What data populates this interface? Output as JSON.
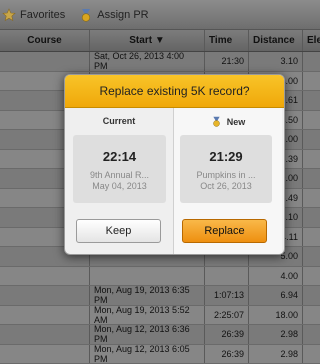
{
  "toolbar": {
    "items": [
      {
        "label": "Favorites",
        "icon": "star-icon"
      },
      {
        "label": "Assign PR",
        "icon": "medal-icon"
      }
    ]
  },
  "table": {
    "headers": [
      "Course",
      "Start ▼",
      "Time",
      "Distance",
      "Elev"
    ],
    "rows": [
      {
        "start": "Sat, Oct 26, 2013 4:00 PM",
        "time": "21:30",
        "distance": "3.10"
      },
      {
        "start": "",
        "time": "",
        "distance": "4.00"
      },
      {
        "start": "",
        "time": "",
        "distance": "26.61"
      },
      {
        "start": "",
        "time": "",
        "distance": "4.50"
      },
      {
        "start": "",
        "time": "",
        "distance": "6.00"
      },
      {
        "start": "",
        "time": "",
        "distance": "26.39"
      },
      {
        "start": "",
        "time": "",
        "distance": "9.00"
      },
      {
        "start": "",
        "time": "",
        "distance": "15.49"
      },
      {
        "start": "",
        "time": "",
        "distance": "3.10"
      },
      {
        "start": "",
        "time": "",
        "distance": "4.11"
      },
      {
        "start": "",
        "time": "",
        "distance": "5.00"
      },
      {
        "start": "",
        "time": "",
        "distance": "4.00"
      },
      {
        "start": "Mon, Aug 19, 2013 6:35 PM",
        "time": "1:07:13",
        "distance": "6.94"
      },
      {
        "start": "Mon, Aug 19, 2013 5:52 AM",
        "time": "2:25:07",
        "distance": "18.00"
      },
      {
        "start": "Mon, Aug 12, 2013 6:36 PM",
        "time": "26:39",
        "distance": "2.98"
      },
      {
        "start": "Mon, Aug 12, 2013 6:05 PM",
        "time": "26:39",
        "distance": "2.98"
      }
    ]
  },
  "modal": {
    "title": "Replace existing 5K record?",
    "current": {
      "title": "Current",
      "time": "22:14",
      "name": "9th Annual R...",
      "date": "May 04, 2013"
    },
    "new": {
      "title": "New",
      "time": "21:29",
      "name": "Pumpkins in ...",
      "date": "Oct 26, 2013"
    },
    "keep_label": "Keep",
    "replace_label": "Replace"
  },
  "colors": {
    "accent": "#f0a80a",
    "overlay": "#7d7d7d"
  }
}
